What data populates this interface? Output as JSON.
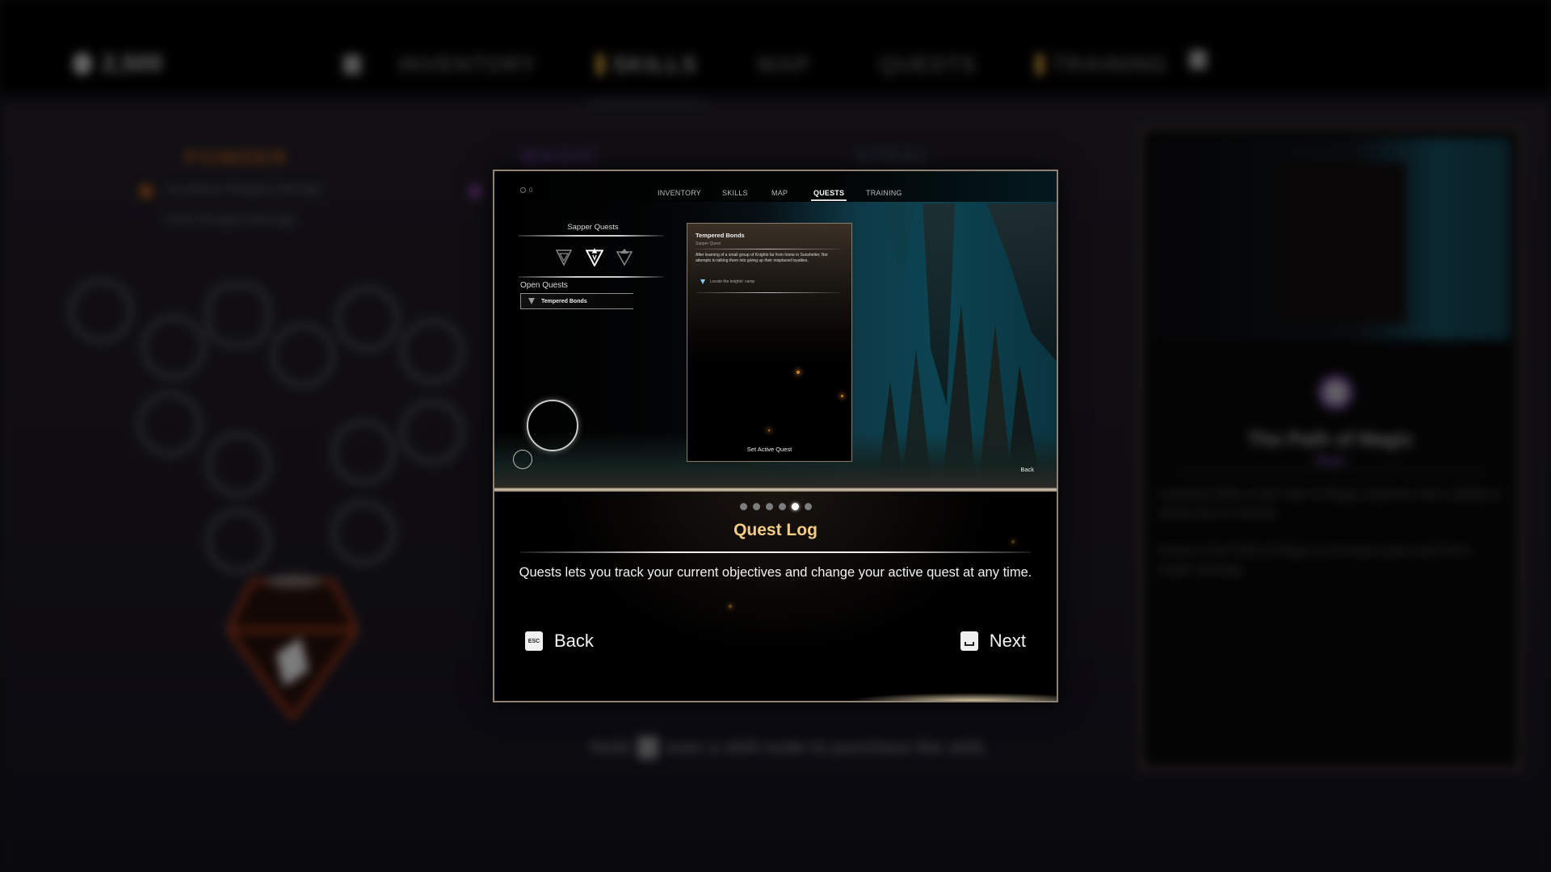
{
  "background": {
    "currency": {
      "icon": "coin-icon",
      "value": "2,500"
    },
    "nav": [
      {
        "label": "INVENTORY",
        "icon": "inventory-icon"
      },
      {
        "label": "SKILLS",
        "icon": "gem-icon",
        "active": true
      },
      {
        "label": "MAP"
      },
      {
        "label": "QUESTS"
      },
      {
        "label": "TRAINING",
        "icon": "gem-icon"
      }
    ],
    "columns": [
      {
        "label": "POWDER",
        "color": "#7a3f14"
      },
      {
        "label": "MAGIC",
        "color": "#4a2d6a"
      },
      {
        "label": "STEEL",
        "color": "#2e3a44"
      }
    ],
    "skill_line_1": "Increases Ranged Damage",
    "skill_line_2": "+50% Ranged Damage",
    "detail_panel": {
      "title": "The Path of Magic",
      "subtitle": "Magic",
      "paragraph_1": "Learning Skills in the Path of Magic improves Nor's ability to assist you in combat.",
      "paragraph_2": "Invest in the Path of Magic to increase yours and Nor's magic damage."
    },
    "hint": {
      "before": "Hold",
      "after": "over a skill node to purchase the skill."
    }
  },
  "modal": {
    "screenshot": {
      "currency": "0",
      "nav": [
        {
          "label": "INVENTORY"
        },
        {
          "label": "SKILLS"
        },
        {
          "label": "MAP"
        },
        {
          "label": "QUESTS",
          "active": true
        },
        {
          "label": "TRAINING"
        }
      ],
      "category_title": "Sapper Quests",
      "open_quests_title": "Open Quests",
      "open_quests": [
        {
          "label": "Tempered Bonds"
        }
      ],
      "quest_detail": {
        "title": "Tempered Bonds",
        "type": "Sapper Quest",
        "description": "After learning of a small group of Knights far from home in Sunshelter, Nor attempts to talking them into giving up their misplaced loyalties.",
        "objective": "Locate the knights' camp",
        "action": "Set Active Quest"
      },
      "back_label": "Back"
    },
    "page_indicator": {
      "total": 6,
      "current": 5
    },
    "title": "Quest Log",
    "description": "Quests lets you track your current objectives and change your active quest at any time.",
    "back_button": {
      "key": "ESC",
      "label": "Back"
    },
    "next_button": {
      "key": "SPACE",
      "label": "Next"
    },
    "colors": {
      "title": "#f3cc86",
      "border": "#8e8273"
    }
  }
}
